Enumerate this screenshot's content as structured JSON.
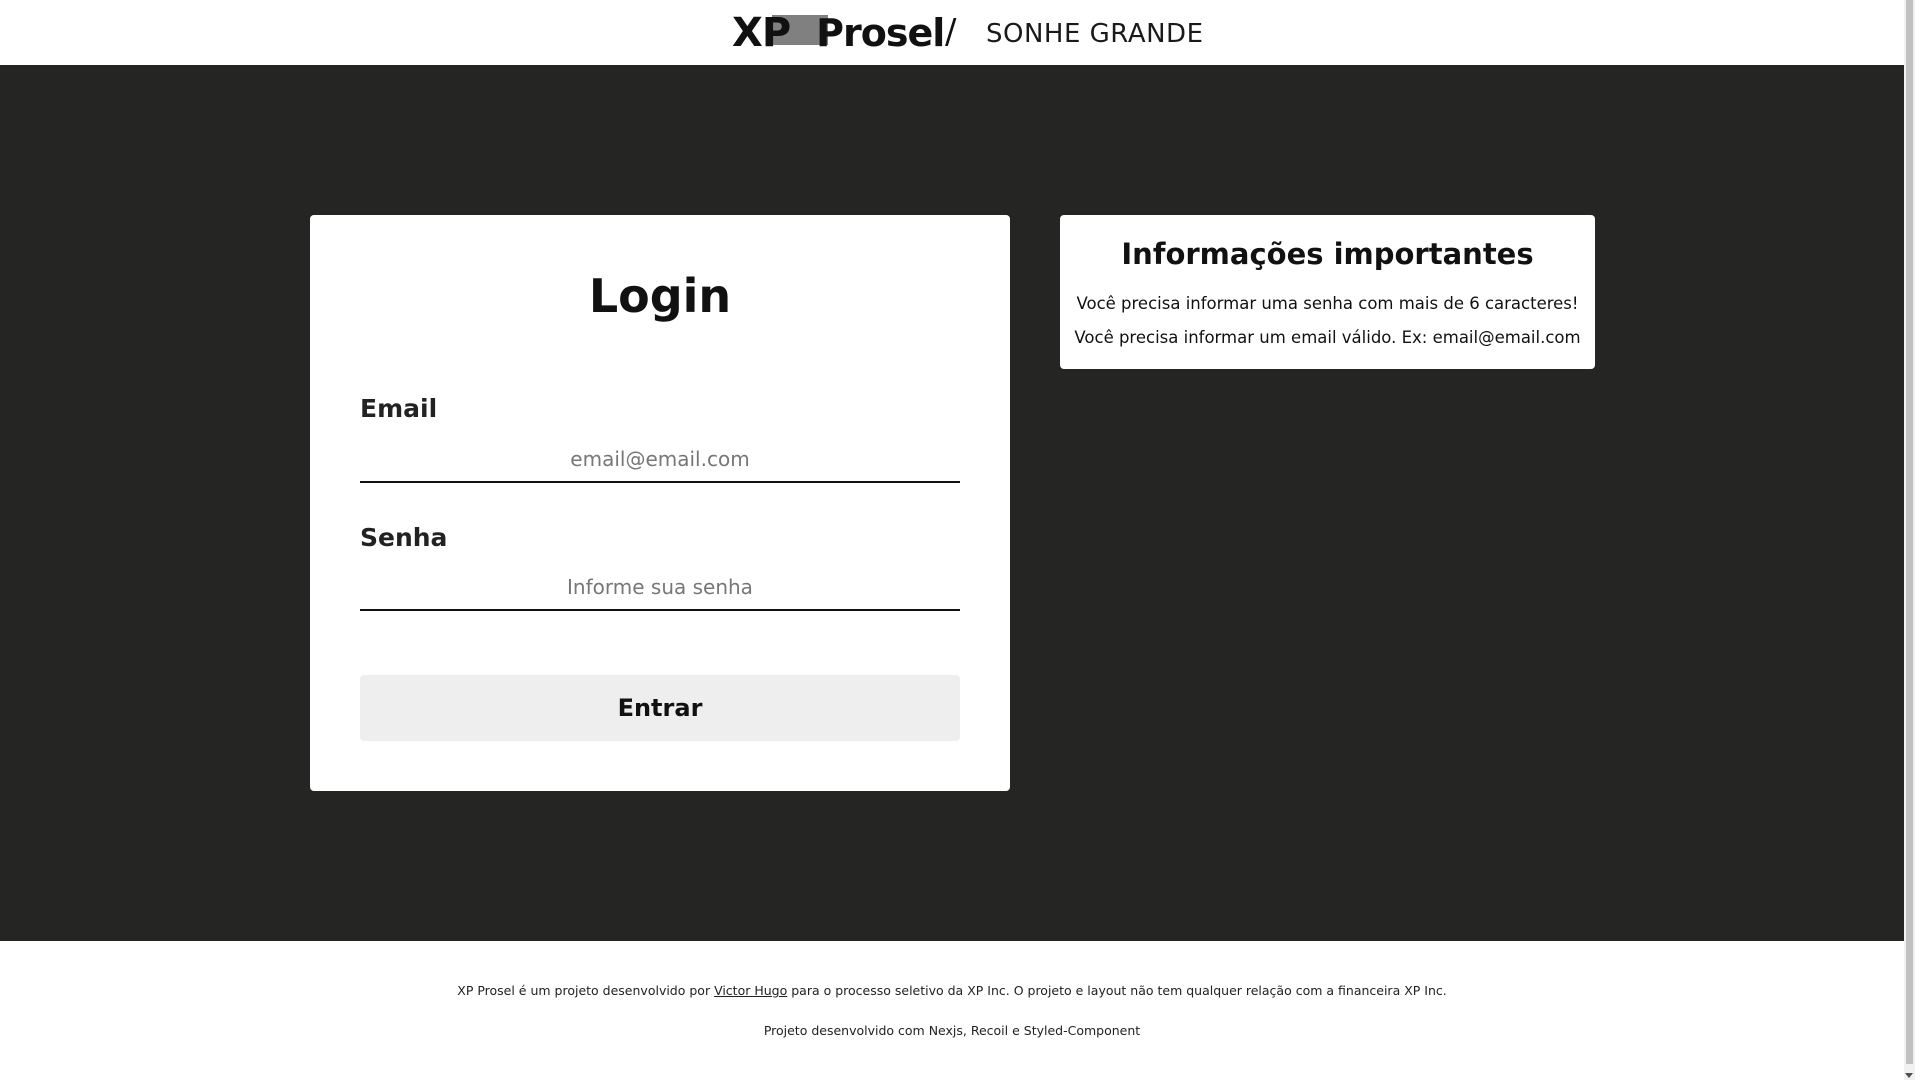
{
  "header": {
    "logo_xp": "XP",
    "logo_prosel": "Prosel",
    "slash": "/",
    "tagline": "SONHE GRANDE"
  },
  "login": {
    "title": "Login",
    "email_label": "Email",
    "email_placeholder": "email@email.com",
    "senha_label": "Senha",
    "senha_placeholder": "Informe sua senha",
    "submit_label": "Entrar"
  },
  "info": {
    "title": "Informações importantes",
    "lines": [
      "Você precisa informar uma senha com mais de 6 caracteres!",
      "Você precisa informar um email válido. Ex: email@email.com"
    ]
  },
  "footer": {
    "line1_before": "XP Prosel é um projeto desenvolvido por ",
    "line1_link": "Victor Hugo",
    "line1_after": " para o processo seletivo da XP Inc. O projeto e layout não tem qualquer relação com a financeira XP Inc.",
    "line2": "Projeto desenvolvido com Nexjs, Recoil e Styled-Component"
  },
  "colors": {
    "background_dark": "#252623",
    "card": "#ffffff",
    "button": "#eeeeee",
    "logo_block": "#808080"
  },
  "icons": {
    "scroll_down": "chevron-down-icon"
  }
}
